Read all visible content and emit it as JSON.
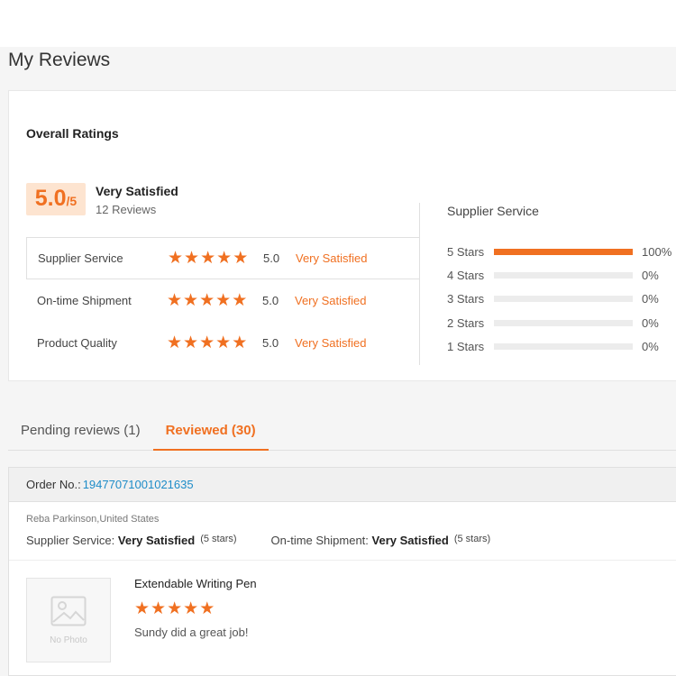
{
  "page": {
    "title": "My Reviews"
  },
  "overall": {
    "title": "Overall Ratings",
    "score": "5.0",
    "score_max": "/5",
    "label": "Very Satisfied",
    "count": "12 Reviews"
  },
  "ratings": [
    {
      "name": "Supplier Service",
      "stars": 5,
      "value": "5.0",
      "verdict": "Very Satisfied"
    },
    {
      "name": "On-time Shipment",
      "stars": 5,
      "value": "5.0",
      "verdict": "Very Satisfied"
    },
    {
      "name": "Product Quality",
      "stars": 5,
      "value": "5.0",
      "verdict": "Very Satisfied"
    }
  ],
  "distribution": {
    "title": "Supplier Service",
    "rows": [
      {
        "label": "5 Stars",
        "percent": 100,
        "percent_text": "100%"
      },
      {
        "label": "4 Stars",
        "percent": 0,
        "percent_text": "0%"
      },
      {
        "label": "3 Stars",
        "percent": 0,
        "percent_text": "0%"
      },
      {
        "label": "2 Stars",
        "percent": 0,
        "percent_text": "0%"
      },
      {
        "label": "1 Stars",
        "percent": 0,
        "percent_text": "0%"
      }
    ]
  },
  "tabs": [
    {
      "label": "Pending reviews (1)",
      "active": false
    },
    {
      "label": "Reviewed (30)",
      "active": true
    }
  ],
  "order": {
    "label": "Order No.:",
    "number": "19477071001021635",
    "reviewer": "Reba Parkinson,United States",
    "supplier_service_label": "Supplier Service:",
    "supplier_service_value": "Very Satisfied",
    "supplier_service_stars": "(5 stars)",
    "shipment_label": "On-time Shipment:",
    "shipment_value": "Very Satisfied",
    "shipment_stars": "(5 stars)",
    "no_photo": "No Photo",
    "product_name": "Extendable Writing Pen",
    "product_stars": 5,
    "comment": "Sundy did a great job!"
  },
  "colors": {
    "accent": "#f07021",
    "link": "#1e8cc8",
    "score_bg": "#fde4d0"
  },
  "icons": {
    "star": "star-icon",
    "photo": "image-placeholder-icon"
  }
}
